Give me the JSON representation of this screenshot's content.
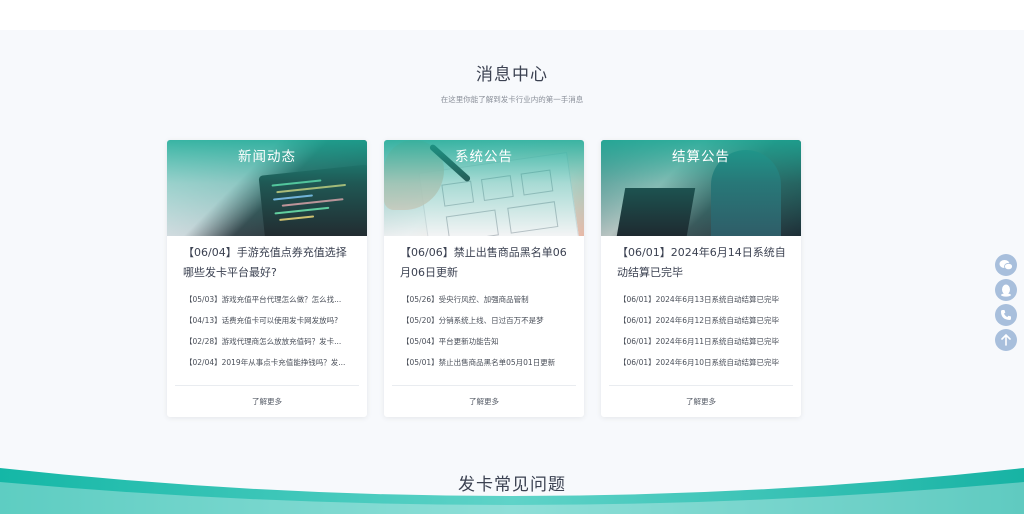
{
  "section": {
    "title": "消息中心",
    "subtitle": "在这里你能了解到发卡行业内的第一手消息"
  },
  "cards": [
    {
      "label": "新闻动态",
      "headline": "【06/04】手游充值点券充值选择哪些发卡平台最好?",
      "items": [
        "【05/03】游戏充值平台代理怎么做？怎么找...",
        "【04/13】话费充值卡可以使用发卡网发放吗?",
        "【02/28】游戏代理商怎么放放充值码？发卡...",
        "【02/04】2019年从事点卡充值能挣钱吗？发..."
      ],
      "more": "了解更多"
    },
    {
      "label": "系统公告",
      "headline": "【06/06】禁止出售商品黑名单06月06日更新",
      "items": [
        "【05/26】受央行风控、加强商品管制",
        "【05/20】分销系统上线、日过百万不是梦",
        "【05/04】平台更新功能告知",
        "【05/01】禁止出售商品黑名单05月01日更新"
      ],
      "more": "了解更多"
    },
    {
      "label": "结算公告",
      "headline": "【06/01】2024年6月14日系统自动结算已完毕",
      "items": [
        "【06/01】2024年6月13日系统自动结算已完毕",
        "【06/01】2024年6月12日系统自动结算已完毕",
        "【06/01】2024年6月11日系统自动结算已完毕",
        "【06/01】2024年6月10日系统自动结算已完毕"
      ],
      "more": "了解更多"
    }
  ],
  "float_buttons": [
    "wechat-icon",
    "qq-icon",
    "phone-icon",
    "back-to-top-icon"
  ],
  "faq": {
    "title": "发卡常见问题"
  },
  "colors": {
    "accent": "#1aaa96",
    "float": "#a8bfdc"
  }
}
